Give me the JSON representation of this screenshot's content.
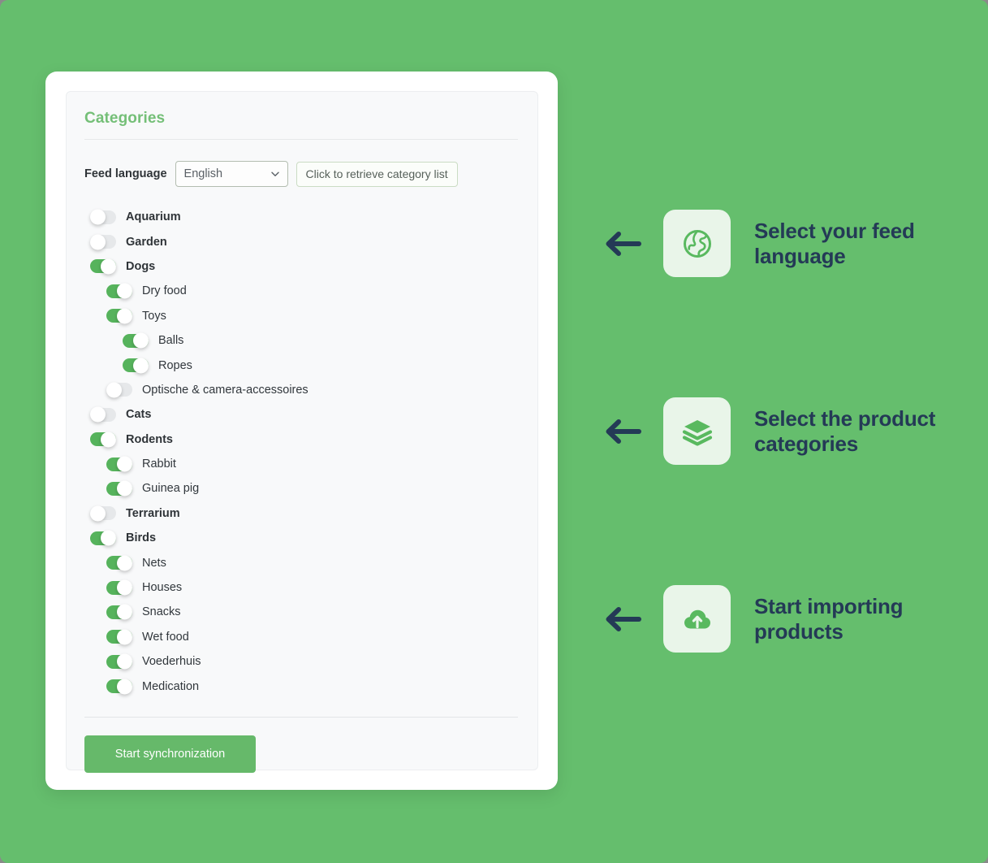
{
  "theme": {
    "background_green": "#65be6d",
    "accent_green": "#66b96a",
    "toggle_on_green": "#56b35c",
    "toggle_off_gray": "#e6e8ea",
    "heading_green": "#74bf77",
    "callout_navy": "#243a56",
    "icon_tile_bg": "#e9f5e9"
  },
  "panel": {
    "title": "Categories",
    "feed_language": {
      "label": "Feed language",
      "selected": "English",
      "options": [
        "English"
      ],
      "chevron_icon": "chevron-down-icon"
    },
    "retrieve_button": "Click to retrieve category list",
    "sync_button": "Start synchronization"
  },
  "categories": [
    {
      "label": "Aquarium",
      "level": 0,
      "on": false
    },
    {
      "label": "Garden",
      "level": 0,
      "on": false
    },
    {
      "label": "Dogs",
      "level": 0,
      "on": true
    },
    {
      "label": "Dry food",
      "level": 1,
      "on": true
    },
    {
      "label": "Toys",
      "level": 1,
      "on": true
    },
    {
      "label": "Balls",
      "level": 2,
      "on": true
    },
    {
      "label": "Ropes",
      "level": 2,
      "on": true
    },
    {
      "label": "Optische & camera-accessoires",
      "level": 1,
      "on": false
    },
    {
      "label": "Cats",
      "level": 0,
      "on": false
    },
    {
      "label": "Rodents",
      "level": 0,
      "on": true
    },
    {
      "label": "Rabbit",
      "level": 1,
      "on": true
    },
    {
      "label": "Guinea pig",
      "level": 1,
      "on": true
    },
    {
      "label": "Terrarium",
      "level": 0,
      "on": false
    },
    {
      "label": "Birds",
      "level": 0,
      "on": true
    },
    {
      "label": "Nets",
      "level": 1,
      "on": true
    },
    {
      "label": "Houses",
      "level": 1,
      "on": true
    },
    {
      "label": "Snacks",
      "level": 1,
      "on": true
    },
    {
      "label": "Wet food",
      "level": 1,
      "on": true
    },
    {
      "label": "Voederhuis",
      "level": 1,
      "on": true
    },
    {
      "label": "Medication",
      "level": 1,
      "on": true
    }
  ],
  "callouts": [
    {
      "text": "Select your feed language",
      "icon": "globe-icon",
      "arrow_icon": "arrow-left-icon"
    },
    {
      "text": "Select the product categories",
      "icon": "layers-icon",
      "arrow_icon": "arrow-left-icon"
    },
    {
      "text": "Start importing products",
      "icon": "cloud-upload-icon",
      "arrow_icon": "arrow-left-icon"
    }
  ]
}
